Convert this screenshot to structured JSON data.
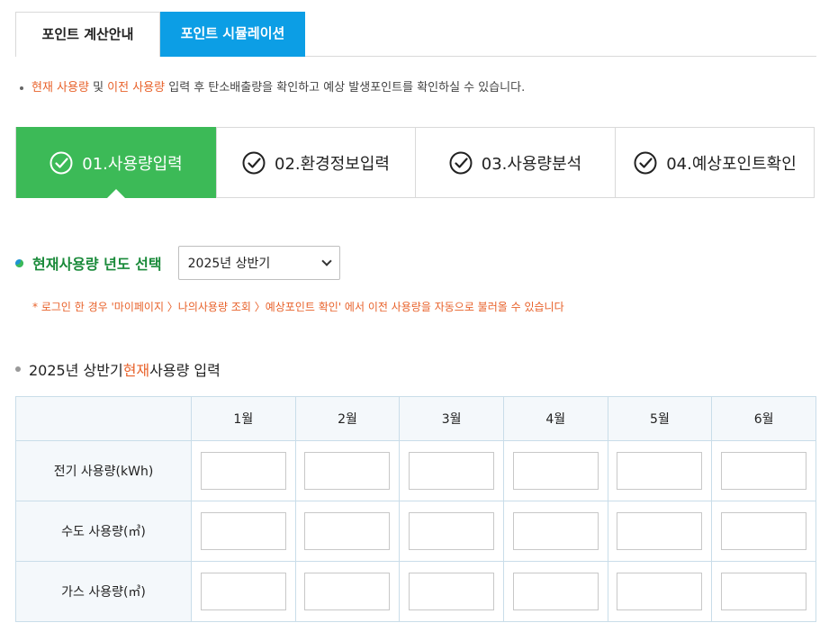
{
  "tabs": [
    {
      "label": "포인트 계산안내",
      "active": false
    },
    {
      "label": "포인트 시뮬레이션",
      "active": true
    }
  ],
  "info": {
    "hl1": "현재 사용량",
    "mid1": " 및 ",
    "hl2": "이전 사용량",
    "rest": " 입력 후 탄소배출량을 확인하고 예상 발생포인트를 확인하실 수 있습니다."
  },
  "steps": [
    {
      "label": "01.사용량입력",
      "active": true
    },
    {
      "label": "02.환경정보입력",
      "active": false
    },
    {
      "label": "03.사용량분석",
      "active": false
    },
    {
      "label": "04.예상포인트확인",
      "active": false
    }
  ],
  "year": {
    "label": "현재사용량 년도 선택",
    "selected": "2025년 상반기"
  },
  "notice": "* 로그인 한 경우 '마이페이지 〉나의사용량 조회 〉예상포인트 확인' 에서 이전 사용량을 자동으로 불러올 수 있습니다",
  "section": {
    "pre": "2025년 상반기 ",
    "hl": "현재",
    "post": " 사용량 입력"
  },
  "table": {
    "months": [
      "1월",
      "2월",
      "3월",
      "4월",
      "5월",
      "6월"
    ],
    "rows": [
      "전기 사용량(kWh)",
      "수도 사용량(㎥)",
      "가스 사용량(㎥)"
    ]
  },
  "colors": {
    "tab_active": "#0c9ee5",
    "step_active": "#3cba57",
    "highlight": "#e8622b"
  }
}
